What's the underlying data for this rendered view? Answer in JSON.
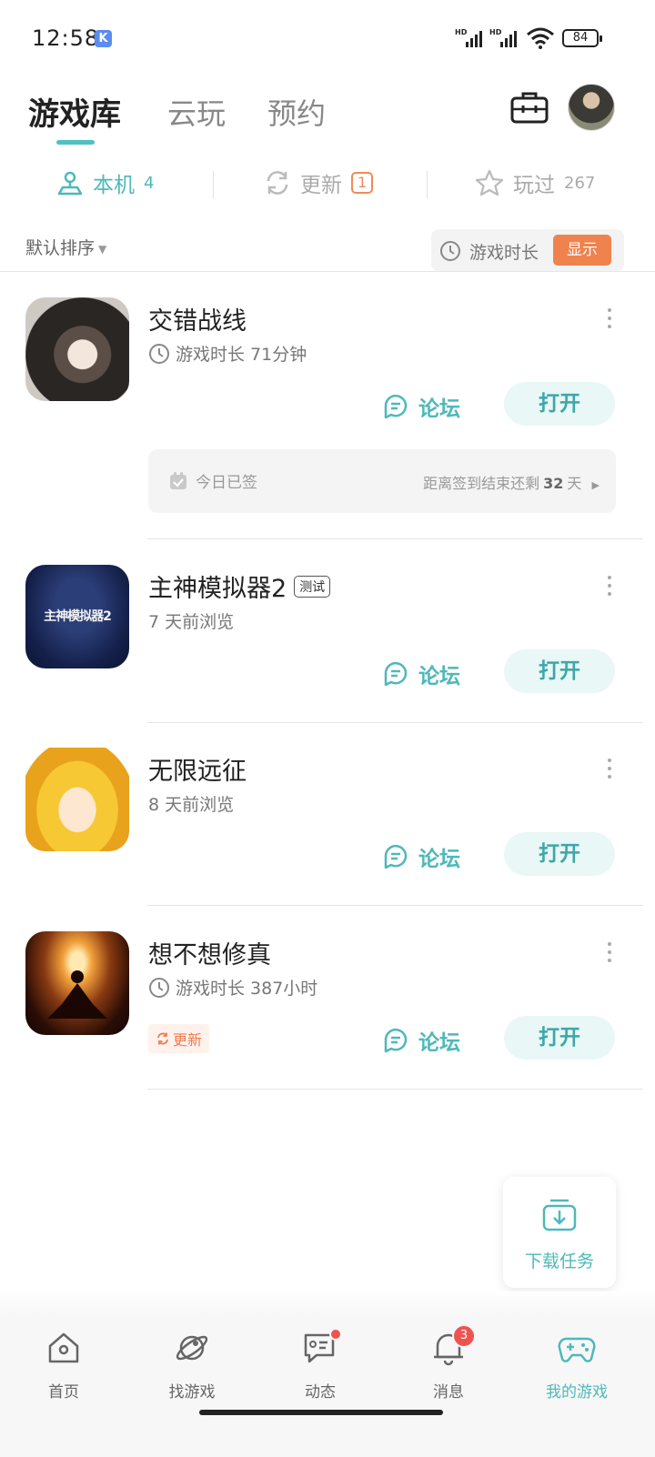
{
  "status_bar": {
    "time": "12:58",
    "app_badge": "K",
    "battery": "84"
  },
  "header": {
    "tabs": [
      {
        "label": "游戏库",
        "active": true
      },
      {
        "label": "云玩",
        "active": false
      },
      {
        "label": "预约",
        "active": false
      }
    ]
  },
  "subtabs": [
    {
      "label": "本机",
      "count": "4",
      "icon": "device-icon",
      "active": true
    },
    {
      "label": "更新",
      "count": "1",
      "icon": "refresh-icon",
      "active": false
    },
    {
      "label": "玩过",
      "count": "267",
      "icon": "star-icon",
      "active": false
    }
  ],
  "sort": {
    "label": "默认排序",
    "playtime_label": "游戏时长",
    "show_label": "显示"
  },
  "games": [
    {
      "title": "交错战线",
      "tag": "",
      "subtitle": "游戏时长 71分钟",
      "has_clock": true,
      "forum": "论坛",
      "open": "打开",
      "update": "",
      "checkin": {
        "left": "今日已签",
        "right_prefix": "距离签到结束还剩",
        "days": "32",
        "right_suffix": "天"
      }
    },
    {
      "title": "主神模拟器2",
      "tag": "测试",
      "subtitle": "7 天前浏览",
      "has_clock": false,
      "forum": "论坛",
      "open": "打开",
      "update": ""
    },
    {
      "title": "无限远征",
      "tag": "",
      "subtitle": "8 天前浏览",
      "has_clock": false,
      "forum": "论坛",
      "open": "打开",
      "update": ""
    },
    {
      "title": "想不想修真",
      "tag": "",
      "subtitle": "游戏时长 387小时",
      "has_clock": true,
      "forum": "论坛",
      "open": "打开",
      "update": "更新"
    }
  ],
  "game2_icon_text": "主神模拟器2",
  "download_task": {
    "label": "下载任务"
  },
  "bottom_nav": [
    {
      "label": "首页",
      "icon": "home-icon",
      "active": false
    },
    {
      "label": "找游戏",
      "icon": "planet-icon",
      "active": false
    },
    {
      "label": "动态",
      "icon": "chat-icon",
      "active": false,
      "dot": true
    },
    {
      "label": "消息",
      "icon": "bell-icon",
      "active": false,
      "badge": "3"
    },
    {
      "label": "我的游戏",
      "icon": "gamepad-icon",
      "active": true
    }
  ],
  "colors": {
    "accent": "#4fb8b9",
    "orange": "#f0824e",
    "badge_red": "#ef5350"
  }
}
